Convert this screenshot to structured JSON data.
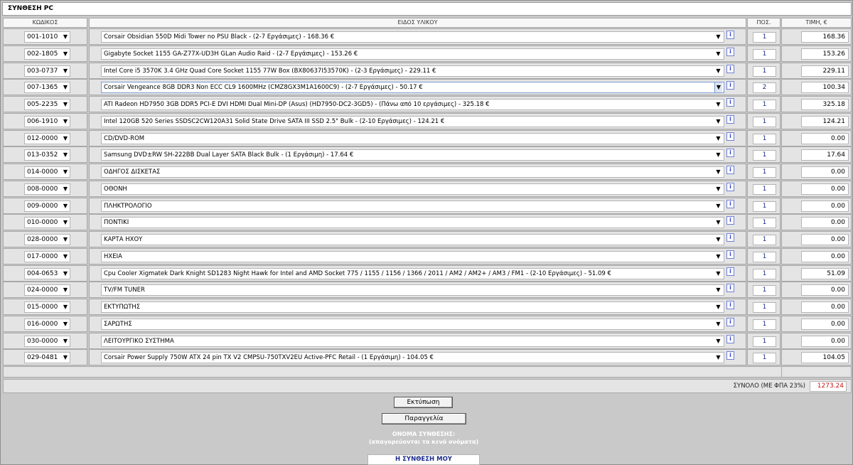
{
  "title": "ΣΥΝΘΕΣΗ PC",
  "headers": {
    "code": "ΚΩΔΙΚΟΣ",
    "item": "ΕΙΔΟΣ ΥΛΙΚΟΥ",
    "qty": "ΠΟΣ.",
    "price": "ΤΙΜΗ, €"
  },
  "info_glyph": "i",
  "dropdown_glyph": "▼",
  "rows": [
    {
      "code": "001-1010",
      "item": "Corsair Obsidian 550D Midi Tower no PSU Black - (2-7 Εργάσιμες) - 168.36 €",
      "qty": "1",
      "price": "168.36"
    },
    {
      "code": "002-1805",
      "item": "Gigabyte Socket 1155 GA-Z77X-UD3H GLan Audio Raid - (2-7 Εργάσιμες) - 153.26 €",
      "qty": "1",
      "price": "153.26"
    },
    {
      "code": "003-0737",
      "item": "Intel Core i5 3570K 3.4 GHz Quad Core Socket 1155 77W Box (BX80637I53570K) - (2-3 Εργάσιμες) - 229.11 €",
      "qty": "1",
      "price": "229.11"
    },
    {
      "code": "007-1365",
      "item": "Corsair Vengeance 8GB DDR3 Non ECC CL9 1600MHz (CMZ8GX3M1A1600C9) - (2-7 Εργάσιμες) - 50.17 €",
      "qty": "2",
      "price": "100.34",
      "active": true
    },
    {
      "code": "005-2235",
      "item": "ATI Radeon HD7950 3GB DDR5 PCI-E DVI HDMI Dual Mini-DP (Asus) (HD7950-DC2-3GD5) - (Πάνω από 10 εργάσιμες) - 325.18 €",
      "qty": "1",
      "price": "325.18"
    },
    {
      "code": "006-1910",
      "item": "Intel 120GB 520 Series SSDSC2CW120A31 Solid State Drive SATA III SSD 2.5\" Bulk - (2-10 Εργάσιμες) - 124.21 €",
      "qty": "1",
      "price": "124.21"
    },
    {
      "code": "012-0000",
      "item": "CD/DVD-ROM",
      "qty": "1",
      "price": "0.00"
    },
    {
      "code": "013-0352",
      "item": "Samsung DVD±RW SH-222BB Dual Layer SATA Black Bulk - (1 Εργάσιμη) - 17.64 €",
      "qty": "1",
      "price": "17.64"
    },
    {
      "code": "014-0000",
      "item": "ΟΔΗΓΟΣ ΔΙΣΚΕΤΑΣ",
      "qty": "1",
      "price": "0.00"
    },
    {
      "code": "008-0000",
      "item": "ΟΘΟΝΗ",
      "qty": "1",
      "price": "0.00"
    },
    {
      "code": "009-0000",
      "item": "ΠΛΗΚΤΡΟΛΟΓΙΟ",
      "qty": "1",
      "price": "0.00"
    },
    {
      "code": "010-0000",
      "item": "ΠΟΝΤΙΚΙ",
      "qty": "1",
      "price": "0.00"
    },
    {
      "code": "028-0000",
      "item": "ΚΑΡΤΑ ΗΧΟΥ",
      "qty": "1",
      "price": "0.00"
    },
    {
      "code": "017-0000",
      "item": "ΗΧΕΙΑ",
      "qty": "1",
      "price": "0.00"
    },
    {
      "code": "004-0653",
      "item": "Cpu Cooler Xigmatek Dark Knight SD1283 Night Hawk for Intel and AMD Socket 775 / 1155 / 1156 / 1366 / 2011 / AM2 / AM2+ / AM3 / FM1 - (2-10 Εργάσιμες) - 51.09 €",
      "qty": "1",
      "price": "51.09"
    },
    {
      "code": "024-0000",
      "item": "TV/FM TUNER",
      "qty": "1",
      "price": "0.00"
    },
    {
      "code": "015-0000",
      "item": "ΕΚΤΥΠΩΤΗΣ",
      "qty": "1",
      "price": "0.00"
    },
    {
      "code": "016-0000",
      "item": "ΣΑΡΩΤΗΣ",
      "qty": "1",
      "price": "0.00"
    },
    {
      "code": "030-0000",
      "item": "ΛΕΙΤΟΥΡΓΙΚΟ ΣΥΣΤΗΜΑ",
      "qty": "1",
      "price": "0.00"
    },
    {
      "code": "029-0481",
      "item": "Corsair Power Supply 750W ATX 24 pin TX V2 CMPSU-750TXV2EU Active-PFC Retail - (1 Εργάσιμη) - 104.05 €",
      "qty": "1",
      "price": "104.05"
    }
  ],
  "total": {
    "label": "ΣΥΝΟΛΟ (ΜΕ ΦΠΑ 23%)",
    "value": "1273.24"
  },
  "buttons": {
    "print": "Εκτύπωση",
    "order": "Παραγγελία"
  },
  "config_name": {
    "label": "ΟΝΟΜΑ ΣΥΝΘΕΣΗΣ:",
    "hint": "(απαγορεύονται τα κενό ονόματα)",
    "value": "Η ΣΥΝΘΕΣΗ ΜΟΥ"
  },
  "colors": {
    "total_value": "#c01818",
    "info_icon": "#3644c8",
    "label_text": "#ffffff",
    "input_text": "#1b2b8a"
  }
}
